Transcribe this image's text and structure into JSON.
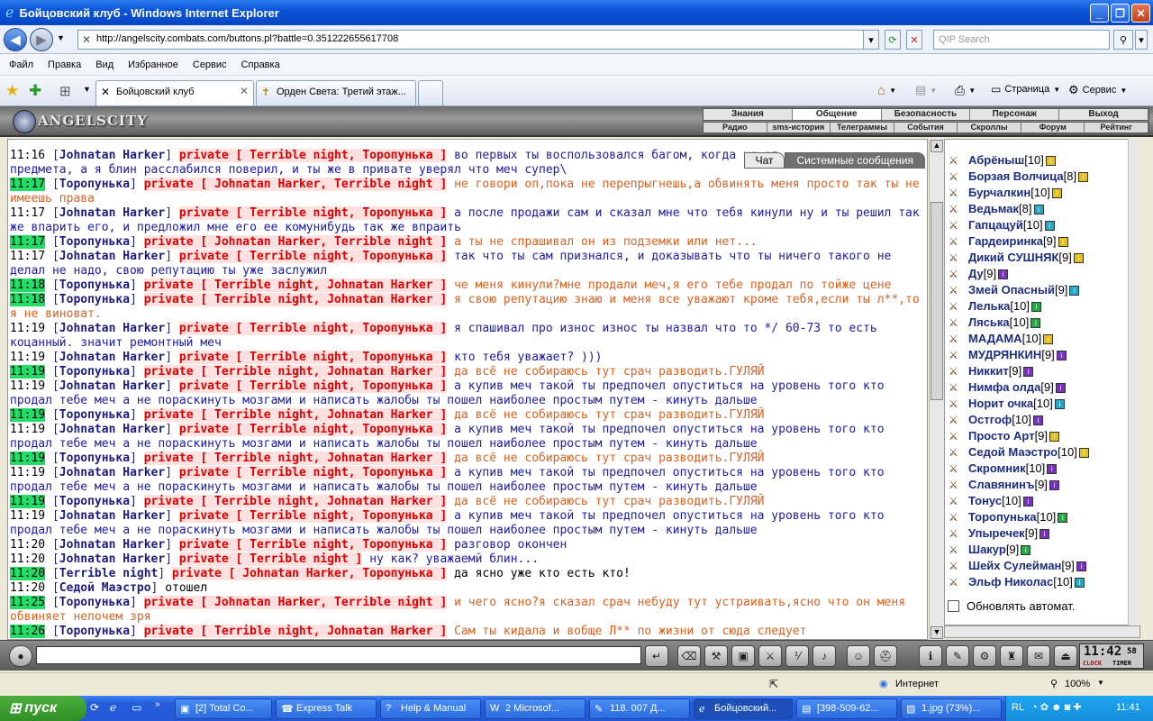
{
  "window": {
    "title": "Бойцовский клуб - Windows Internet Explorer"
  },
  "address": {
    "url": "http://angelscity.combats.com/buttons.pl?battle=0.351222655617708",
    "search_placeholder": "QIP Search"
  },
  "menu": [
    "Файл",
    "Правка",
    "Вид",
    "Избранное",
    "Сервис",
    "Справка"
  ],
  "tabs": [
    {
      "label": "Бойцовский клуб"
    },
    {
      "label": "Орден Света: Третий этаж..."
    }
  ],
  "toolbar_right": {
    "page": "Страница",
    "service": "Сервис"
  },
  "game": {
    "logo": "ANGELSCITY",
    "nav_top": [
      "Знания",
      "Общение",
      "Безопасность",
      "Персонаж",
      "Выход"
    ],
    "nav_bottom": [
      "Радио",
      "sms-история",
      "Телеграммы",
      "События",
      "Скроллы",
      "Форум",
      "Рейтинг"
    ],
    "chat_tabs": [
      "Чат",
      "Системные сообщения"
    ],
    "chat": [
      {
        "time": "11:16",
        "hl": false,
        "user": "Johnatan Harker",
        "to": "private [ Terrible night, Торопунька ]",
        "msg": "во первых ты воспользовался багом, когда не от",
        "or": false
      },
      {
        "time": "",
        "hl": false,
        "user": "",
        "to": "",
        "msg": "предмета, а я блин расслабился поверил, и ты же в привате уверял что меч супер\\",
        "or": false
      },
      {
        "time": "11:17",
        "hl": true,
        "user": "Торопунька",
        "to": "private [ Johnatan Harker, Terrible night ]",
        "msg": "не говори оп,пока не перепрыгнешь,а обвинять меня просто так ты не имеешь права",
        "or": true
      },
      {
        "time": "11:17",
        "hl": false,
        "user": "Johnatan Harker",
        "to": "private [ Terrible night, Торопунька ]",
        "msg": "а после продажи сам и сказал мне что тебя кинули ну и ты решил так же впарить его, и предложил мне его ее комунибудь так же впраить",
        "or": false
      },
      {
        "time": "11:17",
        "hl": true,
        "user": "Торопунька",
        "to": "private [ Johnatan Harker, Terrible night ]",
        "msg": "а ты не спрашивал он из подземки или нет...",
        "or": true
      },
      {
        "time": "11:17",
        "hl": false,
        "user": "Johnatan Harker",
        "to": "private [ Terrible night, Торопунька ]",
        "msg": "так что ты сам признался, и доказывать что ты ничего такого не делал не надо, свою репутацию ты уже заслужил",
        "or": false
      },
      {
        "time": "11:18",
        "hl": true,
        "user": "Торопунька",
        "to": "private [ Terrible night, Johnatan Harker ]",
        "msg": "че меня кинули?мне продали меч,я его тебе продал по тойже цене",
        "or": true
      },
      {
        "time": "11:18",
        "hl": true,
        "user": "Торопунька",
        "to": "private [ Terrible night, Johnatan Harker ]",
        "msg": "я свою репутацию знаю и меня все уважают кроме тебя,если ты л**,то я не виноват.",
        "or": true
      },
      {
        "time": "11:19",
        "hl": false,
        "user": "Johnatan Harker",
        "to": "private [ Terrible night, Торопунька ]",
        "msg": "я спашивал про износ износ ты назвал что то */ 60-73 то есть коцанный. значит ремонтный меч",
        "or": false
      },
      {
        "time": "11:19",
        "hl": false,
        "user": "Johnatan Harker",
        "to": "private [ Terrible night, Торопунька ]",
        "msg": "кто тебя уважает? )))",
        "or": false
      },
      {
        "time": "11:19",
        "hl": true,
        "user": "Торопунька",
        "to": "private [ Terrible night, Johnatan Harker ]",
        "msg": "да всё не собираюсь тут срач разводить.ГУЛЯЙ",
        "or": true
      },
      {
        "time": "11:19",
        "hl": false,
        "user": "Johnatan Harker",
        "to": "private [ Terrible night, Торопунька ]",
        "msg": "а купив меч такой ты предпочел опуститься на уровень того кто продал тебе меч а не пораскинуть мозгами и написать жалобы ты пошел наиболее простым путем - кинуть дальше",
        "or": false
      },
      {
        "time": "11:19",
        "hl": true,
        "user": "Торопунька",
        "to": "private [ Terrible night, Johnatan Harker ]",
        "msg": "да всё не собираюсь тут срач разводить.ГУЛЯЙ",
        "or": true
      },
      {
        "time": "11:19",
        "hl": false,
        "user": "Johnatan Harker",
        "to": "private [ Terrible night, Торопунька ]",
        "msg": "а купив меч такой ты предпочел опуститься на уровень того кто продал тебе меч а не пораскинуть мозгами и написать жалобы ты пошел наиболее простым путем - кинуть дальше",
        "or": false
      },
      {
        "time": "11:19",
        "hl": true,
        "user": "Торопунька",
        "to": "private [ Terrible night, Johnatan Harker ]",
        "msg": "да всё не собираюсь тут срач разводить.ГУЛЯЙ",
        "or": true
      },
      {
        "time": "11:19",
        "hl": false,
        "user": "Johnatan Harker",
        "to": "private [ Terrible night, Торопунька ]",
        "msg": "а купив меч такой ты предпочел опуститься на уровень того кто продал тебе меч а не пораскинуть мозгами и написать жалобы ты пошел наиболее простым путем - кинуть дальше",
        "or": false
      },
      {
        "time": "11:19",
        "hl": true,
        "user": "Торопунька",
        "to": "private [ Terrible night, Johnatan Harker ]",
        "msg": "да всё не собираюсь тут срач разводить.ГУЛЯЙ",
        "or": true
      },
      {
        "time": "11:19",
        "hl": false,
        "user": "Johnatan Harker",
        "to": "private [ Terrible night, Торопунька ]",
        "msg": "а купив меч такой ты предпочел опуститься на уровень того кто продал тебе меч а не пораскинуть мозгами и написать жалобы ты пошел наиболее простым путем - кинуть дальше",
        "or": false
      },
      {
        "time": "11:20",
        "hl": false,
        "user": "Johnatan Harker",
        "to": "private [ Terrible night, Торопунька ]",
        "msg": "разговор окончен",
        "or": false
      },
      {
        "time": "11:20",
        "hl": false,
        "user": "Johnatan Harker",
        "to": "private [ Terrible night ]",
        "msg": "ну как? уважаемй блин...",
        "or": false
      },
      {
        "time": "11:20",
        "hl": true,
        "user": "Terrible night",
        "to": "private [ Johnatan Harker, Торопунька ]",
        "msg": "да ясно уже кто есть кто!",
        "or": false,
        "black": true
      },
      {
        "time": "11:20",
        "hl": false,
        "user": "Седой Маэстро",
        "to": "",
        "msg": "отошел",
        "or": false,
        "black": true
      },
      {
        "time": "11:25",
        "hl": true,
        "user": "Торопунька",
        "to": "private [ Johnatan Harker, Terrible night ]",
        "msg": "и чего ясно?я сказал срач небуду тут устраивать,ясно что он меня обвиняет непочем зря",
        "or": true
      },
      {
        "time": "11:26",
        "hl": true,
        "user": "Торопунька",
        "to": "private [ Terrible night, Johnatan Harker ]",
        "msg": "Сам ты кидала и вобще Л** по жизни от сюда следует",
        "or": true
      }
    ],
    "users": [
      {
        "name": "Абрёныш",
        "lvl": "[10]",
        "b": "y"
      },
      {
        "name": "Борзая Волчица",
        "lvl": "[8]",
        "b": "y"
      },
      {
        "name": "Бурчалкин",
        "lvl": "[10]",
        "b": "y"
      },
      {
        "name": "Ведьмак",
        "lvl": "[8]",
        "b": "c"
      },
      {
        "name": "Гапцацуй",
        "lvl": "[10]",
        "b": "c"
      },
      {
        "name": "Гардеиринка",
        "lvl": "[9]",
        "b": "y"
      },
      {
        "name": "Дикий СУШНЯК",
        "lvl": "[9]",
        "b": "y"
      },
      {
        "name": "Ду",
        "lvl": "[9]",
        "b": "v"
      },
      {
        "name": "Змей Опасный",
        "lvl": "[9]",
        "b": "c"
      },
      {
        "name": "Лелька",
        "lvl": "[10]",
        "b": "g"
      },
      {
        "name": "Ляська",
        "lvl": "[10]",
        "b": "g"
      },
      {
        "name": "МАДАМА",
        "lvl": "[10]",
        "b": "y"
      },
      {
        "name": "МУДРЯНКИН",
        "lvl": "[9]",
        "b": "v"
      },
      {
        "name": "Никкит",
        "lvl": "[9]",
        "b": "v"
      },
      {
        "name": "Нимфа олда",
        "lvl": "[9]",
        "b": "v"
      },
      {
        "name": "Норит очка",
        "lvl": "[10]",
        "b": "c"
      },
      {
        "name": "Остгоф",
        "lvl": "[10]",
        "b": "v"
      },
      {
        "name": "Просто Арт",
        "lvl": "[9]",
        "b": "y"
      },
      {
        "name": "Седой Маэстро",
        "lvl": "[10]",
        "b": "y"
      },
      {
        "name": "Скромник",
        "lvl": "[10]",
        "b": "v"
      },
      {
        "name": "Славянинъ",
        "lvl": "[9]",
        "b": "v"
      },
      {
        "name": "Тонус",
        "lvl": "[10]",
        "b": "v"
      },
      {
        "name": "Торопунька",
        "lvl": "[10]",
        "b": "g"
      },
      {
        "name": "Упыречек",
        "lvl": "[9]",
        "b": "v"
      },
      {
        "name": "Шакур",
        "lvl": "[9]",
        "b": "g"
      },
      {
        "name": "Шейх Сулейман",
        "lvl": "[9]",
        "b": "v"
      },
      {
        "name": "Эльф Николас",
        "lvl": "[10]",
        "b": "c"
      }
    ],
    "auto_refresh": "Обновлять автомат.",
    "clock": {
      "time": "11:42",
      "sec": "58",
      "clock": "CLOCK",
      "timer": "TIMER"
    }
  },
  "status": {
    "zone": "Интернет",
    "zoom": "100%"
  },
  "taskbar": {
    "start": "пуск",
    "items": [
      "[2] Total Co...",
      "Express Talk",
      "Help & Manual",
      "2 Microsof...",
      "118. 007 Д...",
      "Бойцовский...",
      "[398-509-62...",
      "1.jpg (73%)..."
    ],
    "lang": "RL",
    "time": "11:41"
  }
}
